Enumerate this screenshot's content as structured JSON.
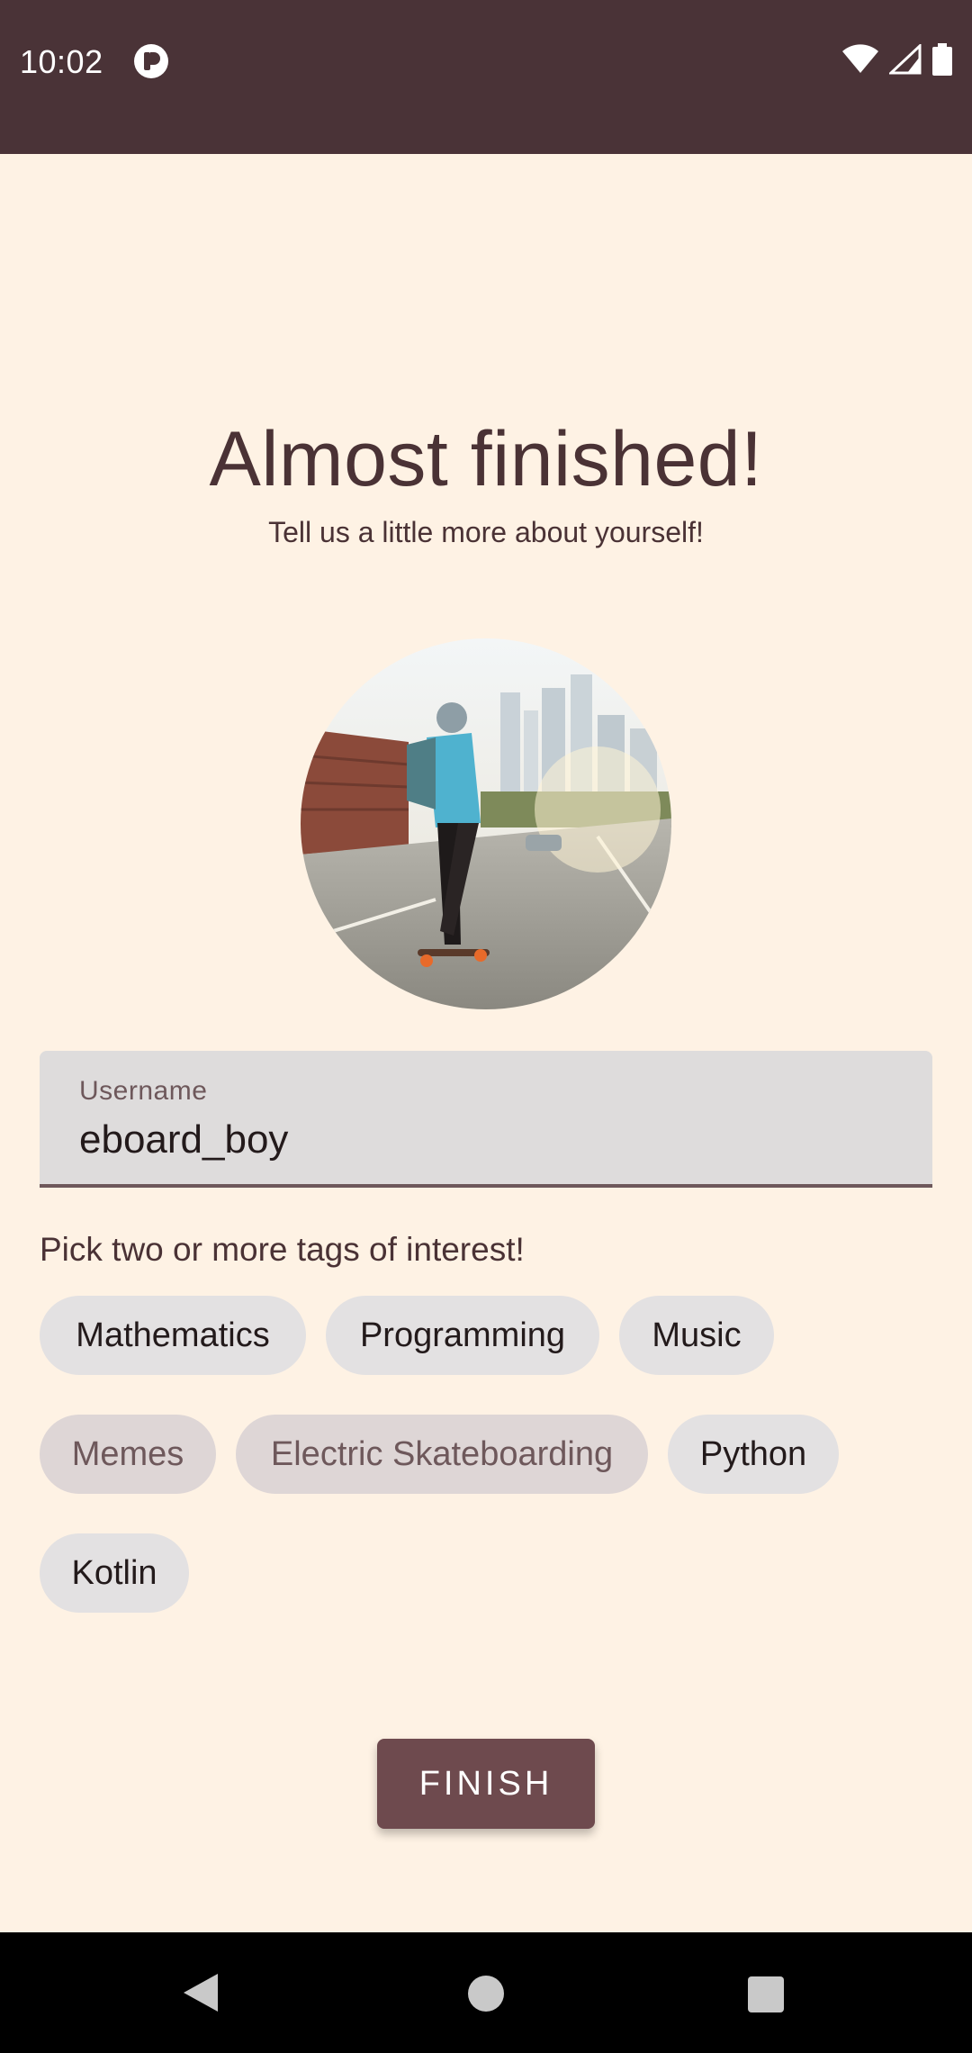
{
  "status_bar": {
    "time": "10:02",
    "app_icon": "notification-app-icon",
    "icons": [
      "wifi-icon",
      "cellular-signal-icon",
      "battery-icon"
    ]
  },
  "header": {
    "title": "Almost finished!",
    "subtitle": "Tell us a little more about yourself!"
  },
  "avatar": {
    "description_icon": "profile-photo"
  },
  "username_field": {
    "label": "Username",
    "value": "eboard_boy"
  },
  "tags": {
    "prompt": "Pick two or more tags of interest!",
    "items": [
      {
        "label": "Mathematics",
        "selected": false
      },
      {
        "label": "Programming",
        "selected": false
      },
      {
        "label": "Music",
        "selected": false
      },
      {
        "label": "Memes",
        "selected": true
      },
      {
        "label": "Electric Skateboarding",
        "selected": true
      },
      {
        "label": "Python",
        "selected": false
      },
      {
        "label": "Kotlin",
        "selected": false
      }
    ]
  },
  "actions": {
    "finish_label": "FINISH"
  },
  "colors": {
    "background": "#FEF2E4",
    "status_bar": "#4A3337",
    "primary": "#6E4A4E",
    "chip": "#E3E1E2",
    "chip_selected": "#DED6D6"
  }
}
